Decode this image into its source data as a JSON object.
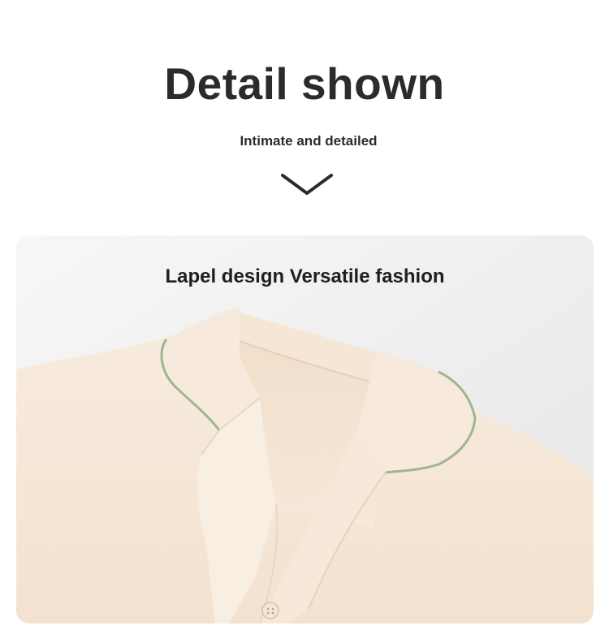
{
  "header": {
    "title": "Detail shown",
    "subtitle": "Intimate and detailed"
  },
  "chevron_icon": "chevron-down-icon",
  "photo": {
    "caption": "Lapel design Versatile fashion",
    "fabric_color": "#f6e7d7",
    "piping_color": "#9fb58e",
    "background_color": "#eeeeee"
  }
}
